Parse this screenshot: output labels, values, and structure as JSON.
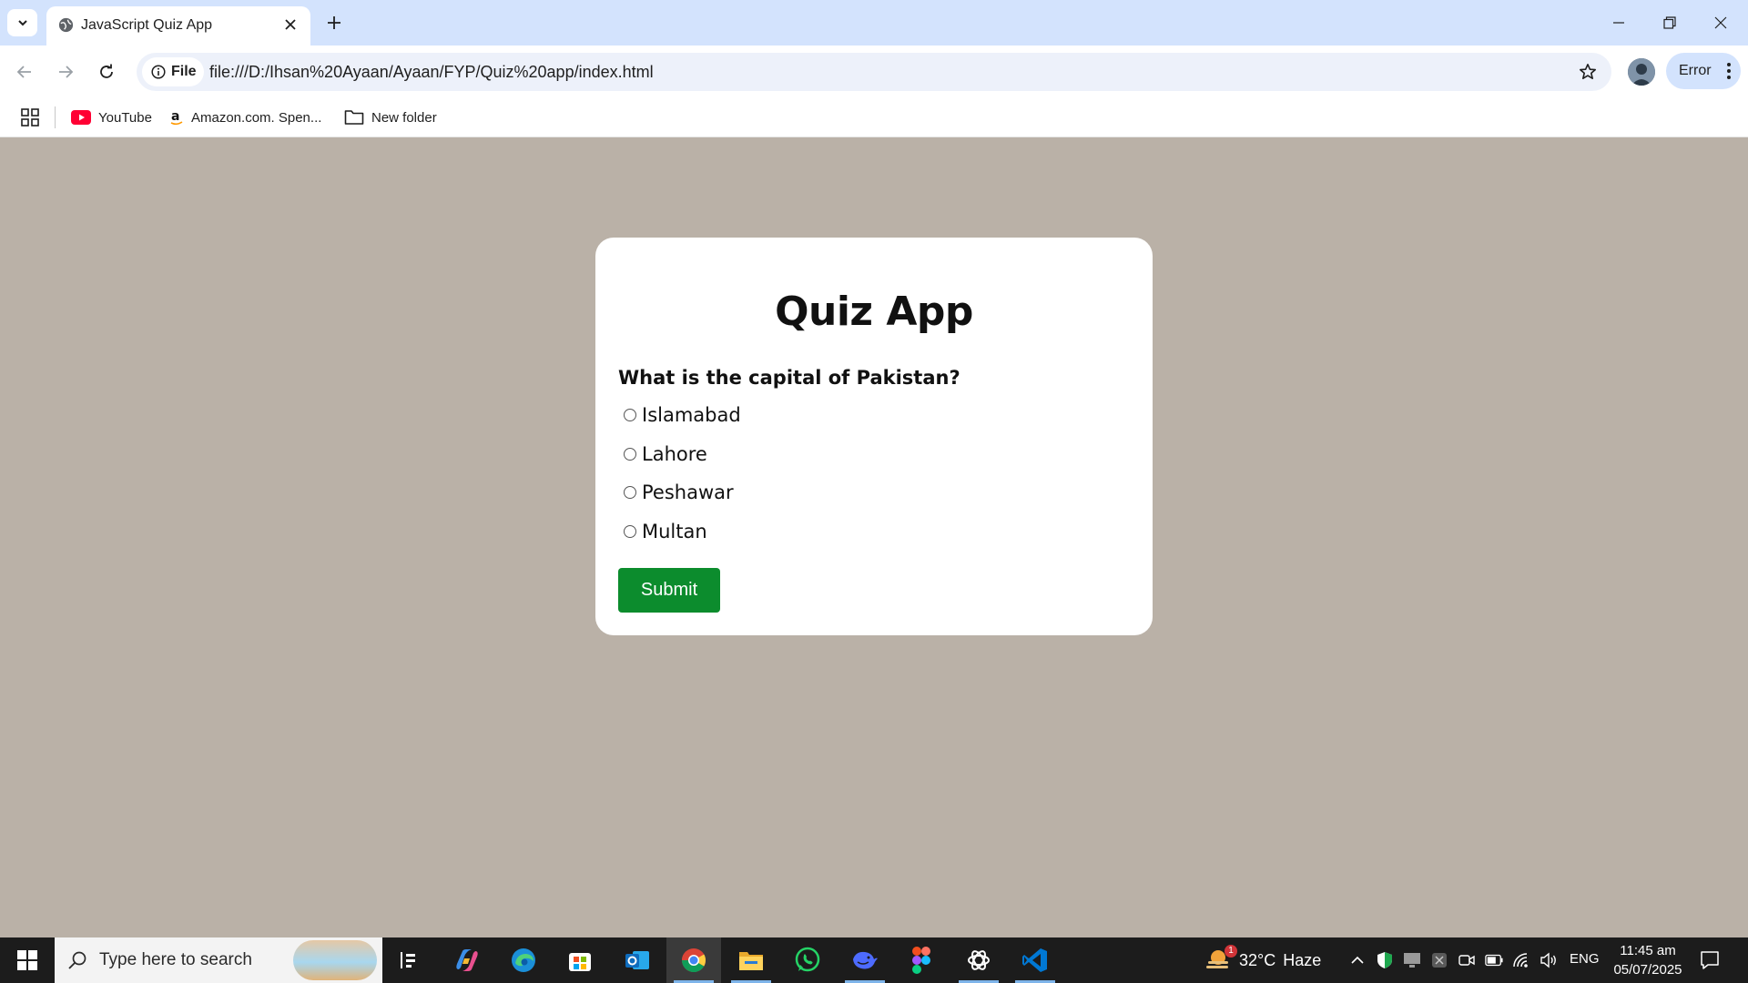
{
  "browser": {
    "tab_title": "JavaScript Quiz App",
    "site_chip_label": "File",
    "url": "file:///D:/Ihsan%20Ayaan/Ayaan/FYP/Quiz%20app/index.html",
    "profile_error_label": "Error",
    "bookmarks": [
      {
        "label": "YouTube",
        "icon": "youtube-icon"
      },
      {
        "label": "Amazon.com. Spen...",
        "icon": "amazon-icon"
      },
      {
        "label": "New folder",
        "icon": "folder-icon"
      }
    ]
  },
  "quiz": {
    "title": "Quiz App",
    "question": "What is the capital of Pakistan?",
    "options": [
      "Islamabad",
      "Lahore",
      "Peshawar",
      "Multan"
    ],
    "selected_option": null,
    "submit_label": "Submit"
  },
  "taskbar": {
    "search_placeholder": "Type here to search",
    "apps": [
      "task-view",
      "copilot",
      "edge",
      "microsoft-store",
      "outlook",
      "chrome",
      "file-explorer",
      "whatsapp",
      "deepseek",
      "figma",
      "chatgpt",
      "vscode"
    ],
    "weather": {
      "temperature": "32°C",
      "condition": "Haze",
      "alert_count": "1"
    },
    "language": "ENG",
    "time": "11:45 am",
    "date": "05/07/2025"
  },
  "colors": {
    "page_background": "#bab1a7",
    "card_background": "#ffffff",
    "submit_button": "#0c8c2d",
    "tab_strip": "#d3e3fd"
  }
}
